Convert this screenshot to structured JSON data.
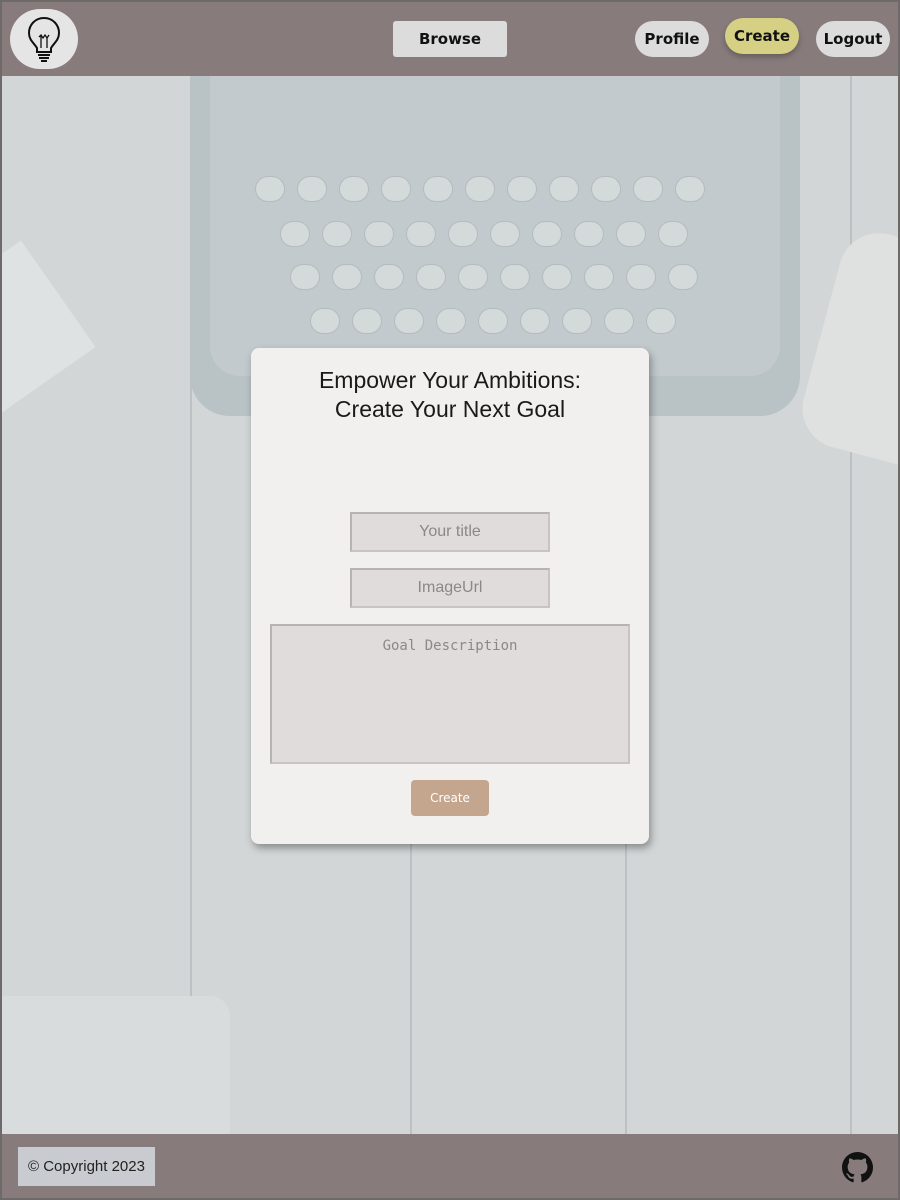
{
  "header": {
    "logo_icon": "lightbulb-icon",
    "nav": {
      "browse_label": "Browse",
      "profile_label": "Profile",
      "create_label": "Create",
      "logout_label": "Logout"
    },
    "active_color": "#d5d084"
  },
  "form": {
    "title": "Empower Your Ambitions: Create Your Next Goal",
    "title_placeholder": "Your title",
    "image_placeholder": "ImageUrl",
    "description_placeholder": "Goal Description",
    "submit_label": "Create",
    "submit_color": "#c4a58e"
  },
  "footer": {
    "copyright": "© Copyright 2023",
    "github_icon": "github-icon"
  },
  "colors": {
    "header_bg": "#887b7b",
    "card_bg": "#f2efef"
  }
}
